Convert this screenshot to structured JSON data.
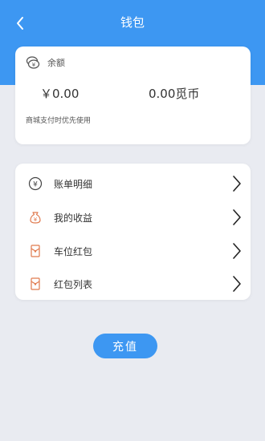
{
  "header": {
    "title": "钱包"
  },
  "balance": {
    "label": "余额",
    "yuan": "￥0.00",
    "coins": "0.00觅币",
    "note": "商城支付时优先使用"
  },
  "menu": {
    "items": [
      {
        "label": "账单明细",
        "icon": "yuan-coin-icon"
      },
      {
        "label": "我的收益",
        "icon": "money-bag-icon"
      },
      {
        "label": "车位红包",
        "icon": "red-envelope-icon"
      },
      {
        "label": "红包列表",
        "icon": "red-envelope-icon"
      }
    ]
  },
  "actions": {
    "recharge": "充值"
  },
  "colors": {
    "primary": "#3d97f2",
    "background": "#e9ebf1",
    "accent_icon": "#e07a4e"
  }
}
